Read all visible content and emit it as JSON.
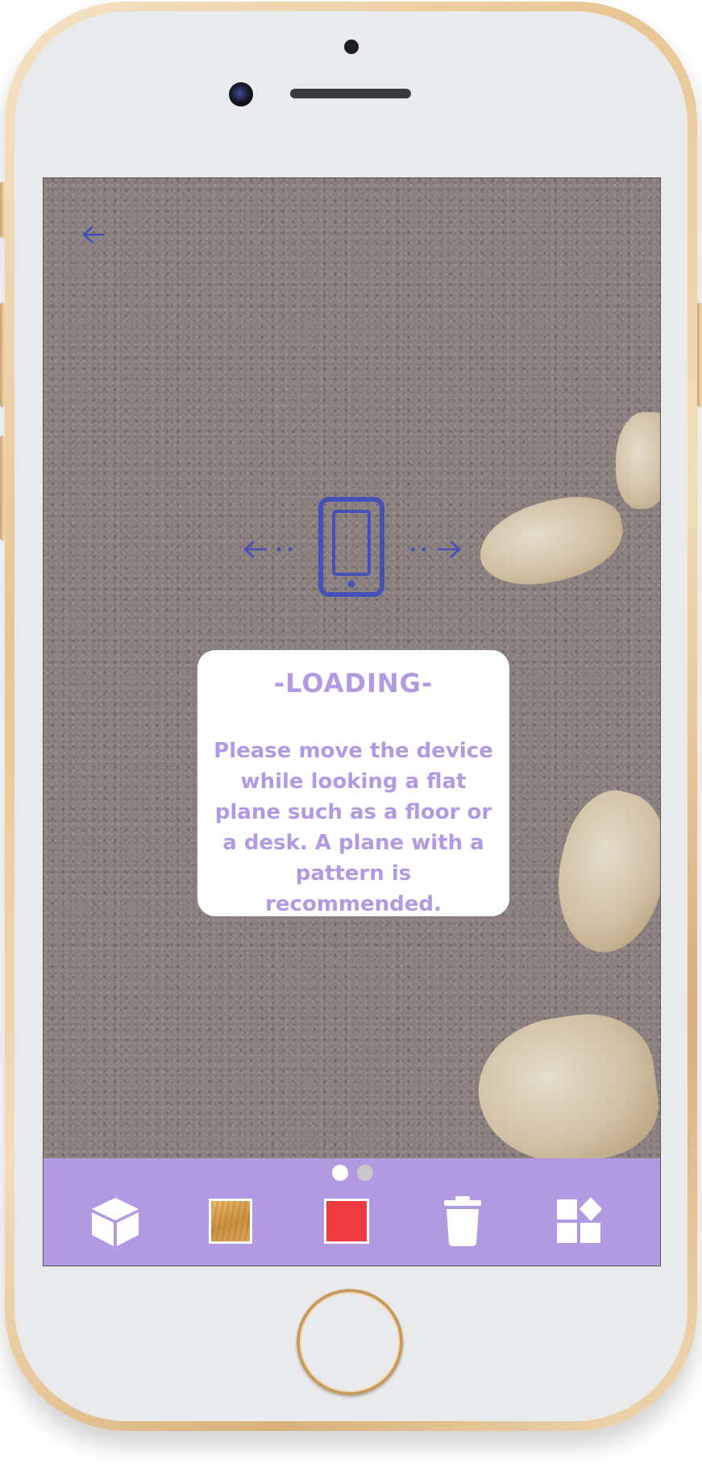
{
  "dialog": {
    "title": "-LOADING-",
    "message": "Please move the device while looking a flat plane such as a floor or a desk. A plane with a pattern is recommended."
  },
  "pagination": {
    "current_page": 1,
    "total_pages": 2
  },
  "toolbar": {
    "items": [
      {
        "icon": "cube-icon"
      },
      {
        "icon": "wood-texture-swatch"
      },
      {
        "icon": "red-color-swatch",
        "color": "#ef3b3f"
      },
      {
        "icon": "trash-icon"
      },
      {
        "icon": "shapes-icon"
      }
    ]
  },
  "colors": {
    "accent": "#b19ae2",
    "icon_blue": "#4451b8",
    "toolbar_bg": "#b19ae2",
    "dialog_bg": "#ffffff",
    "selected_swatch": "#ef3b3f"
  },
  "icons": {
    "back": "arrow-left-icon",
    "hint": "phone-move-icon"
  }
}
